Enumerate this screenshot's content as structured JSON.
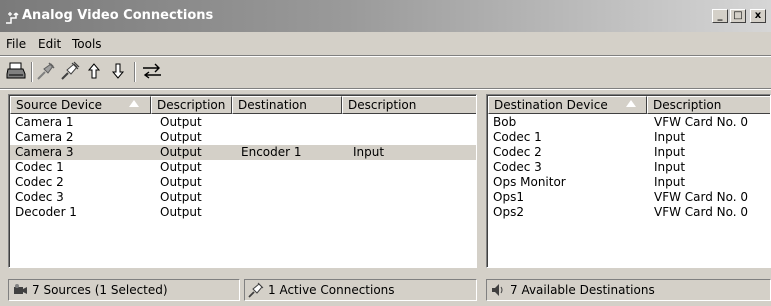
{
  "window": {
    "title": "Analog Video Connections",
    "controls": {
      "minimize": "_",
      "maximize": "□",
      "close": "x"
    }
  },
  "menu": [
    "File",
    "Edit",
    "Tools"
  ],
  "toolbar": {
    "buttons": [
      "print-icon",
      "disconnect-icon",
      "connect-icon",
      "move-up-icon",
      "move-down-icon",
      "swap-icon"
    ]
  },
  "sources": {
    "columns": [
      "Source Device",
      "Description",
      "Destination",
      "Description"
    ],
    "rows": [
      [
        "Camera 1",
        "Output",
        "",
        ""
      ],
      [
        "Camera 2",
        "Output",
        "",
        ""
      ],
      [
        "Camera 3",
        "Output",
        "Encoder 1",
        "Input"
      ],
      [
        "Codec 1",
        "Output",
        "",
        ""
      ],
      [
        "Codec 2",
        "Output",
        "",
        ""
      ],
      [
        "Codec 3",
        "Output",
        "",
        ""
      ],
      [
        "Decoder 1",
        "Output",
        "",
        ""
      ]
    ],
    "selected_row": 2
  },
  "destinations": {
    "columns": [
      "Destination Device",
      "Description"
    ],
    "rows": [
      [
        "Bob",
        "VFW Card No. 0"
      ],
      [
        "Codec 1",
        "Input"
      ],
      [
        "Codec 2",
        "Input"
      ],
      [
        "Codec 3",
        "Input"
      ],
      [
        "Ops Monitor",
        "Input"
      ],
      [
        "Ops1",
        "VFW Card No. 0"
      ],
      [
        "Ops2",
        "VFW Card No. 0"
      ]
    ]
  },
  "status": {
    "sources": "7 Sources  (1 Selected)",
    "connections": "1 Active Connections",
    "destinations": "7 Available Destinations"
  }
}
